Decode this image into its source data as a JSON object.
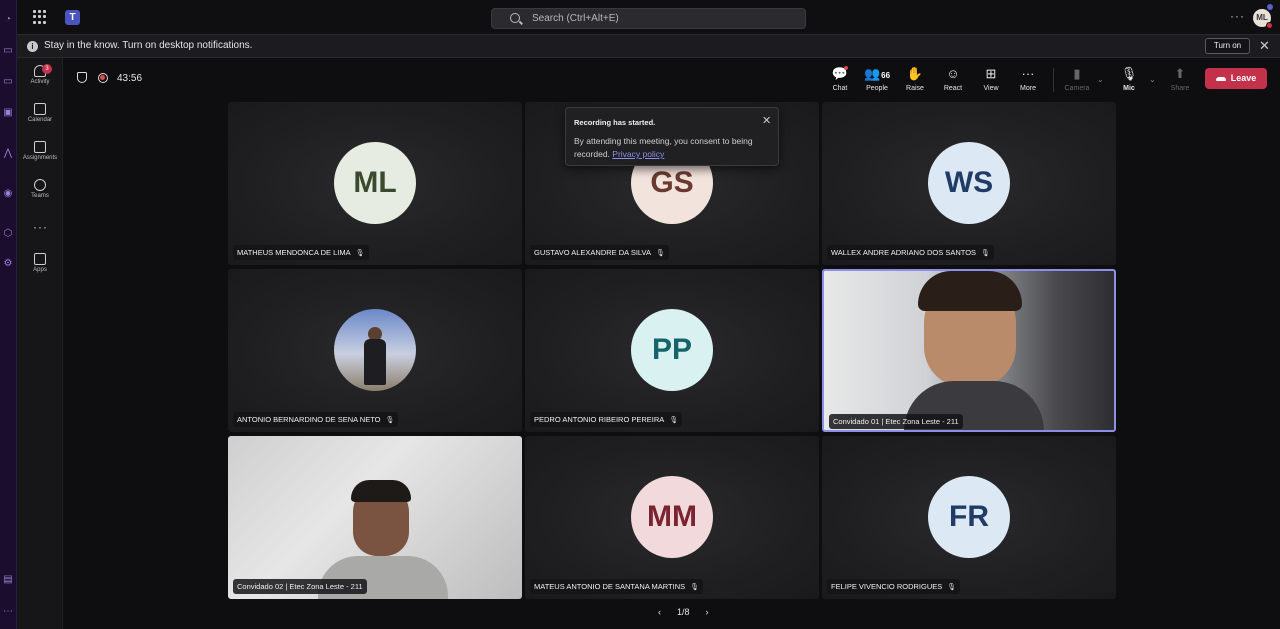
{
  "titlebar": {
    "search_placeholder": "Search (Ctrl+Alt+E)",
    "teams_logo": "T",
    "avatar_initials": "ML",
    "more_dots": "···"
  },
  "notification": {
    "text": "Stay in the know. Turn on desktop notifications.",
    "button": "Turn on",
    "close": "✕"
  },
  "rail": {
    "items": [
      {
        "label": "Activity",
        "badge": "3"
      },
      {
        "label": "Calendar"
      },
      {
        "label": "Assignments"
      },
      {
        "label": "Teams"
      },
      {
        "label": "Apps"
      }
    ],
    "more_dots": "···"
  },
  "meeting": {
    "timer": "43:56",
    "controls": {
      "chat": "Chat",
      "people": "People",
      "people_count": "66",
      "raise": "Raise",
      "react": "React",
      "view": "View",
      "more": "More",
      "camera": "Camera",
      "mic": "Mic",
      "share": "Share",
      "leave": "Leave"
    },
    "icons": {
      "chat": "💬",
      "people": "👥",
      "raise": "✋",
      "react": "☺",
      "view": "⊞",
      "more": "···",
      "camera": "▮",
      "mic": "🎙",
      "share": "⬆",
      "chevron": "⌄",
      "mute": "🎙",
      "close": "✕"
    }
  },
  "popup": {
    "title": "Recording has started.",
    "body": "By attending this meeting, you consent to being recorded.",
    "link": "Privacy policy"
  },
  "tiles": [
    {
      "name": "MATHEUS MENDONCA DE LIMA",
      "initials": "ML",
      "bg": "#e6ece1",
      "fg": "#3a4a2e"
    },
    {
      "name": "GUSTAVO ALEXANDRE DA SILVA",
      "initials": "GS",
      "bg": "#f3e3dd",
      "fg": "#6a3a30"
    },
    {
      "name": "WALLEX ANDRE ADRIANO DOS SANTOS",
      "initials": "WS",
      "bg": "#dce8f4",
      "fg": "#1f3b66"
    },
    {
      "name": "ANTONIO BERNARDINO DE SENA NETO",
      "initials": ""
    },
    {
      "name": "PEDRO ANTONIO RIBEIRO PEREIRA",
      "initials": "PP",
      "bg": "#d9f1f1",
      "fg": "#17636b"
    },
    {
      "name": "Convidado 01 | Etec Zona Leste - 211",
      "initials": ""
    },
    {
      "name": "Convidado 02 | Etec Zona Leste - 211",
      "initials": ""
    },
    {
      "name": "MATEUS ANTONIO DE SANTANA MARTINS",
      "initials": "MM",
      "bg": "#f2d9db",
      "fg": "#7a2430"
    },
    {
      "name": "FELIPE VIVENCIO RODRIGUES",
      "initials": "FR",
      "bg": "#dce8f4",
      "fg": "#1f3b66"
    }
  ],
  "pager": {
    "prev": "‹",
    "label": "1/8",
    "next": "›"
  }
}
